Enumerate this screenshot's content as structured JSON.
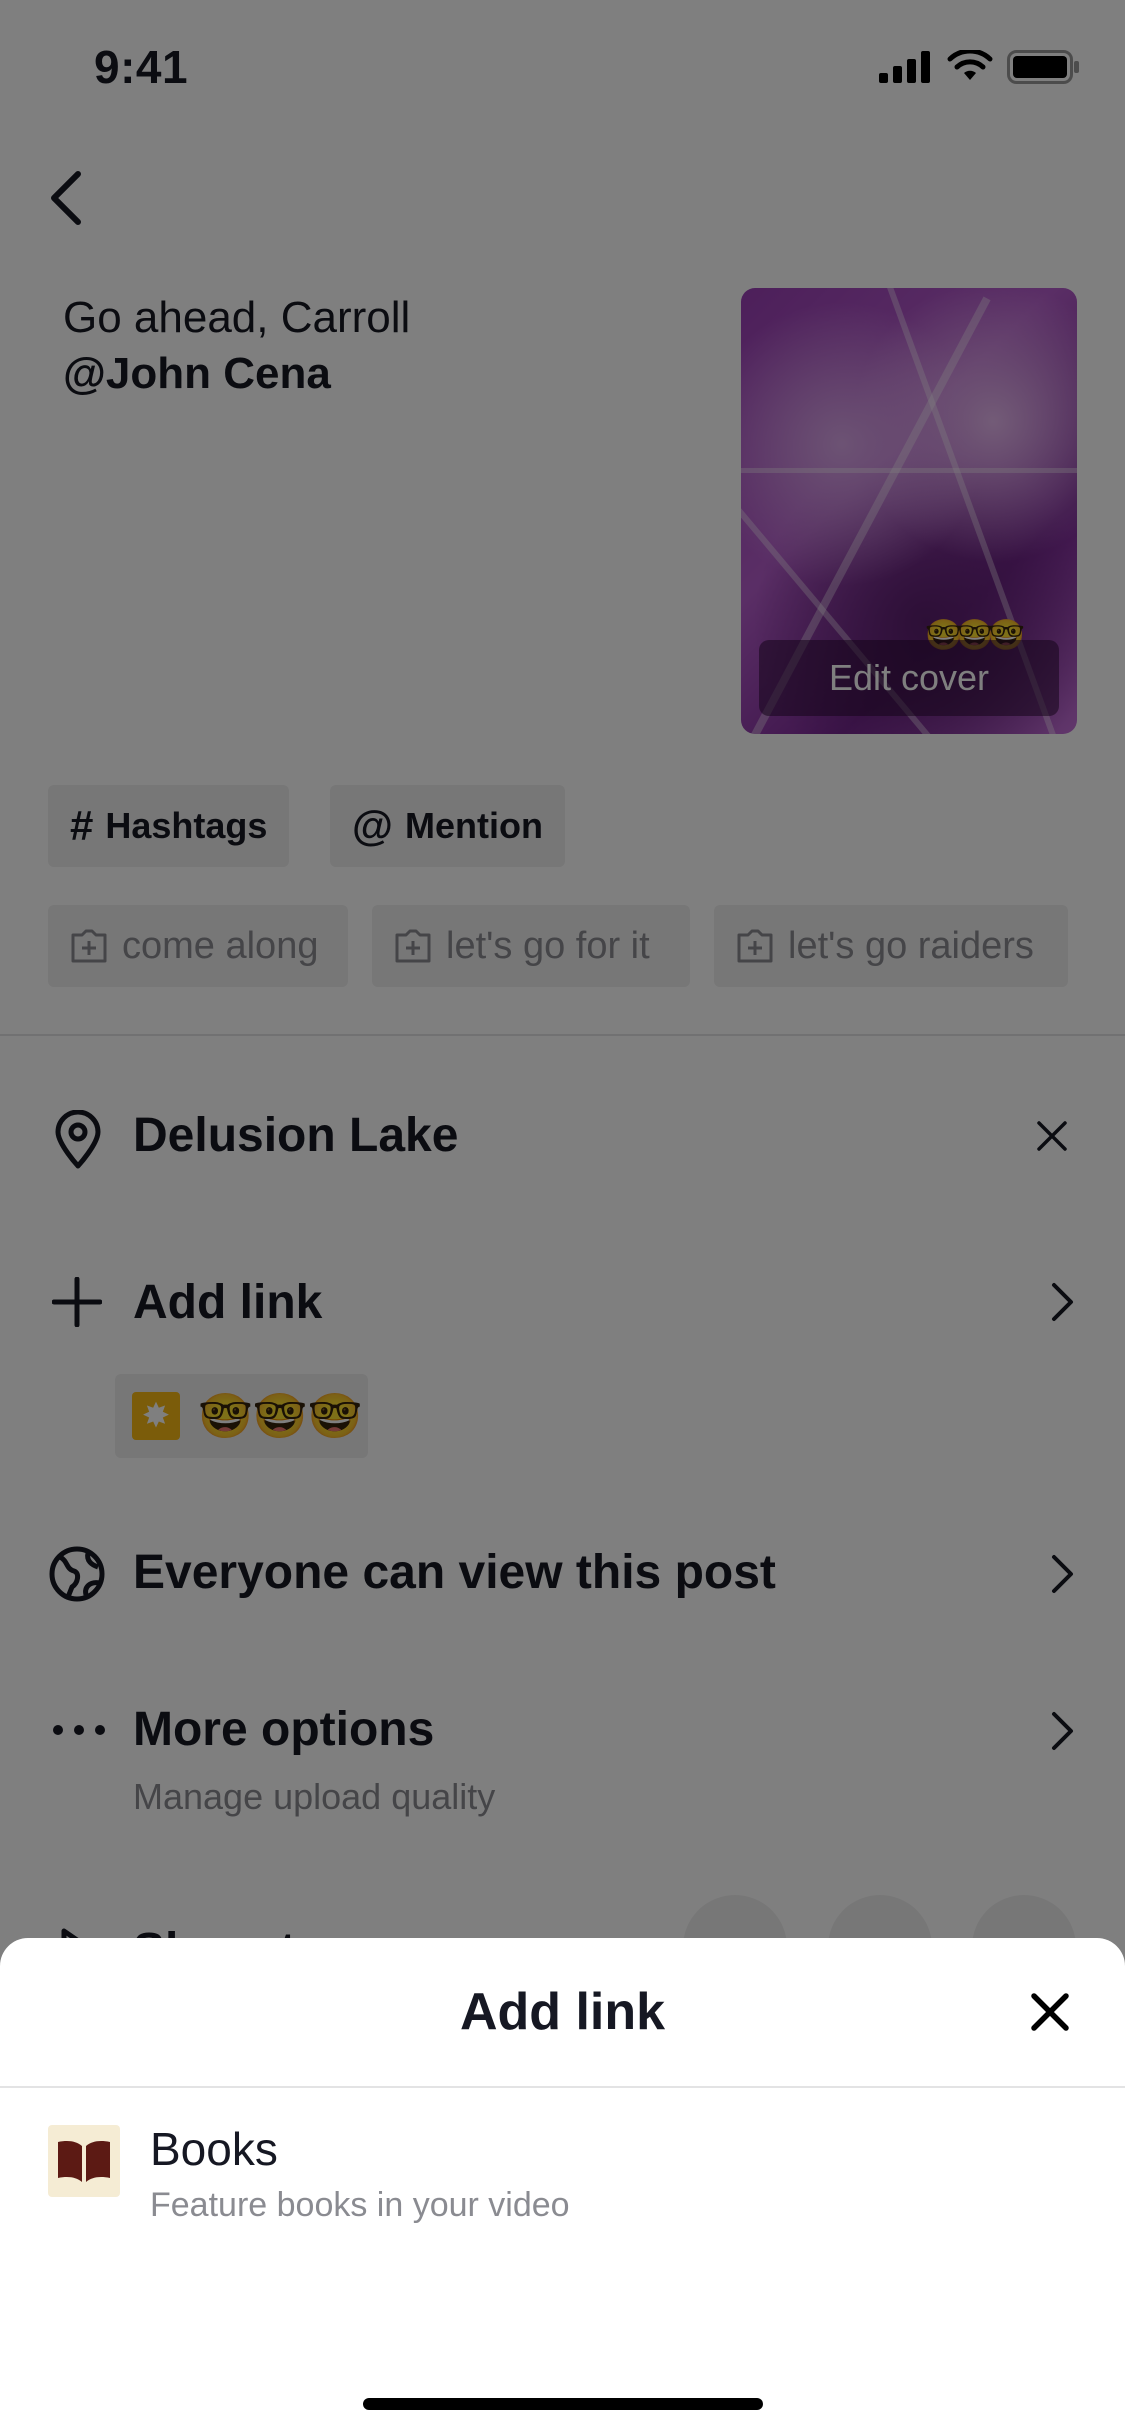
{
  "status_bar": {
    "time": "9:41"
  },
  "caption": {
    "text": "Go ahead, Carroll",
    "mention": "@John Cena"
  },
  "cover": {
    "edit_label": "Edit cover",
    "sticker_emojis": "🤓🤓🤓"
  },
  "chips": {
    "hashtags": "Hashtags",
    "mention": "Mention",
    "hashtag_symbol": "#",
    "mention_symbol": "@"
  },
  "suggestions": [
    "come along",
    "let's go for it",
    "let's go raiders"
  ],
  "location": {
    "label": "Delusion Lake"
  },
  "add_link": {
    "label": "Add link",
    "sticker_emojis": "🤓🤓🤓"
  },
  "privacy": {
    "label": "Everyone can view this post"
  },
  "more_options": {
    "label": "More options",
    "sub": "Manage upload quality"
  },
  "share_partial": {
    "label": "Share to"
  },
  "sheet": {
    "title": "Add link",
    "items": [
      {
        "title": "Books",
        "subtitle": "Feature books in your video",
        "icon": "book-icon",
        "icon_bg": "#f5ecd4",
        "icon_color": "#5c1a14"
      }
    ]
  },
  "colors": {
    "overlay": "rgba(0,0,0,0.5)",
    "text": "#161823",
    "muted": "#8a8b91"
  }
}
